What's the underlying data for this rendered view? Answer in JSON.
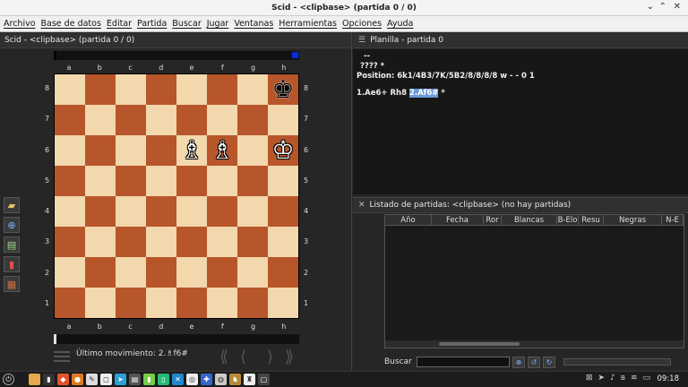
{
  "window": {
    "title": "Scid - <clipbase> (partida 0 / 0)"
  },
  "menu": [
    "Archivo",
    "Base de datos",
    "Editar",
    "Partida",
    "Buscar",
    "Jugar",
    "Ventanas",
    "Herramientas",
    "Opciones",
    "Ayuda"
  ],
  "left": {
    "header": "Scid - <clipbase> (partida 0 / 0)",
    "files": [
      "a",
      "b",
      "c",
      "d",
      "e",
      "f",
      "g",
      "h"
    ],
    "ranks": [
      "8",
      "7",
      "6",
      "5",
      "4",
      "3",
      "2",
      "1"
    ],
    "pieces": [
      {
        "square": "h8",
        "glyph": "♚",
        "color": "black",
        "name": "black-king"
      },
      {
        "square": "e6",
        "glyph": "♗",
        "color": "white",
        "name": "white-bishop"
      },
      {
        "square": "f6",
        "glyph": "♗",
        "color": "white",
        "name": "white-bishop"
      },
      {
        "square": "h6",
        "glyph": "♔",
        "color": "white",
        "name": "white-king"
      }
    ],
    "last_move_label": "Último movimiento: 2.♗f6#"
  },
  "planilla": {
    "header": "Planilla - partida 0",
    "line1": "--",
    "line2": "????  *",
    "position": "Position: 6k1/4B3/7K/5B2/8/8/8/8 w - - 0 1",
    "moves_pre": "1.Ae6+ Rh8 ",
    "moves_hl": "2.Af6#",
    "moves_post": " *"
  },
  "listado": {
    "header": "Listado de partidas: <clipbase> (no hay partidas)",
    "columns": [
      "Año",
      "Fecha",
      "Ror",
      "Blancas",
      "B-Elo",
      "Resu",
      "Negras",
      "N-E"
    ],
    "search_label": "Buscar"
  },
  "taskbar": {
    "time": "09:18"
  }
}
